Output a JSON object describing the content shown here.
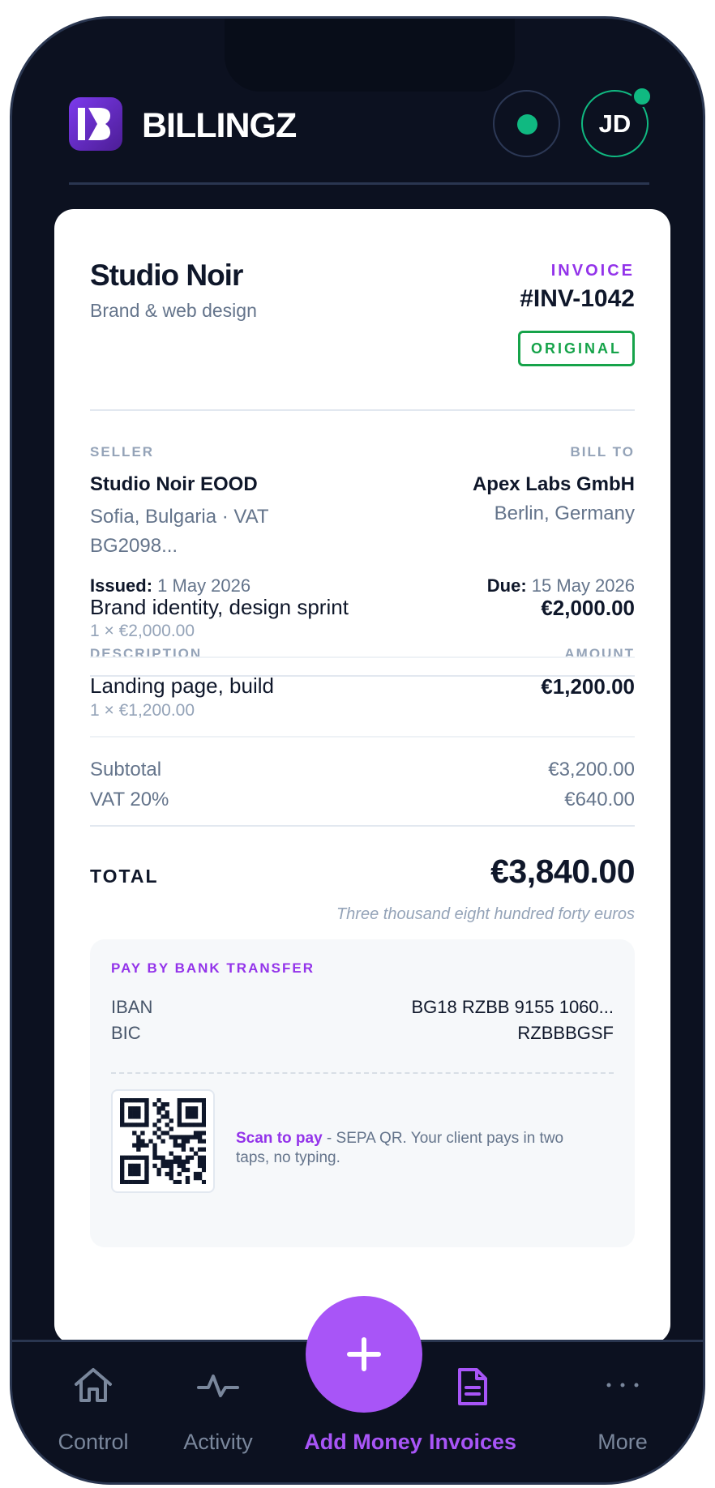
{
  "app": {
    "name": "BILLINGZ",
    "user_initials": "JD"
  },
  "colors": {
    "accent": "#a855f7",
    "online": "#10b981",
    "original_stamp": "#16a34a",
    "background": "#0c1120"
  },
  "invoice": {
    "company_name": "Studio Noir",
    "company_tagline": "Brand & web design",
    "label": "INVOICE",
    "number": "#INV-1042",
    "stamp": "ORIGINAL",
    "seller_caption": "SELLER",
    "seller_name": "Studio Noir EOOD",
    "seller_address": "Sofia, Bulgaria · VAT BG2098...",
    "billto_caption": "BILL TO",
    "buyer_name": "Apex Labs GmbH",
    "buyer_address": "Berlin, Germany",
    "issued_label": "Issued:",
    "issued_date": "1 May 2026",
    "due_label": "Due:",
    "due_date": "15 May 2026",
    "description_header": "DESCRIPTION",
    "amount_header": "AMOUNT",
    "items": [
      {
        "name": "Brand identity, design sprint",
        "detail": "1 × €2,000.00",
        "amount": "€2,000.00"
      },
      {
        "name": "Landing page, build",
        "detail": "1 × €1,200.00",
        "amount": "€1,200.00"
      }
    ],
    "subtotal_label": "Subtotal",
    "subtotal": "€3,200.00",
    "vat_label": "VAT 20%",
    "vat": "€640.00",
    "total_label": "TOTAL",
    "total": "€3,840.00",
    "total_words": "Three thousand eight hundred forty euros",
    "payment": {
      "caption": "PAY BY BANK TRANSFER",
      "iban_label": "IBAN",
      "iban": "BG18 RZBB 9155 1060...",
      "bic_label": "BIC",
      "bic": "RZBBBGSF",
      "scan_title": "Scan to pay",
      "scan_text": " - SEPA QR. Your client pays in two taps, no typing."
    }
  },
  "nav": {
    "control": {
      "label": "Control",
      "icon": "home-icon"
    },
    "activity": {
      "label": "Activity",
      "icon": "activity-icon"
    },
    "add_money": {
      "label": "Add Money",
      "icon": "plus-icon"
    },
    "invoices": {
      "label": "Invoices",
      "icon": "document-icon"
    },
    "more": {
      "label": "More",
      "icon": "more-icon"
    }
  }
}
